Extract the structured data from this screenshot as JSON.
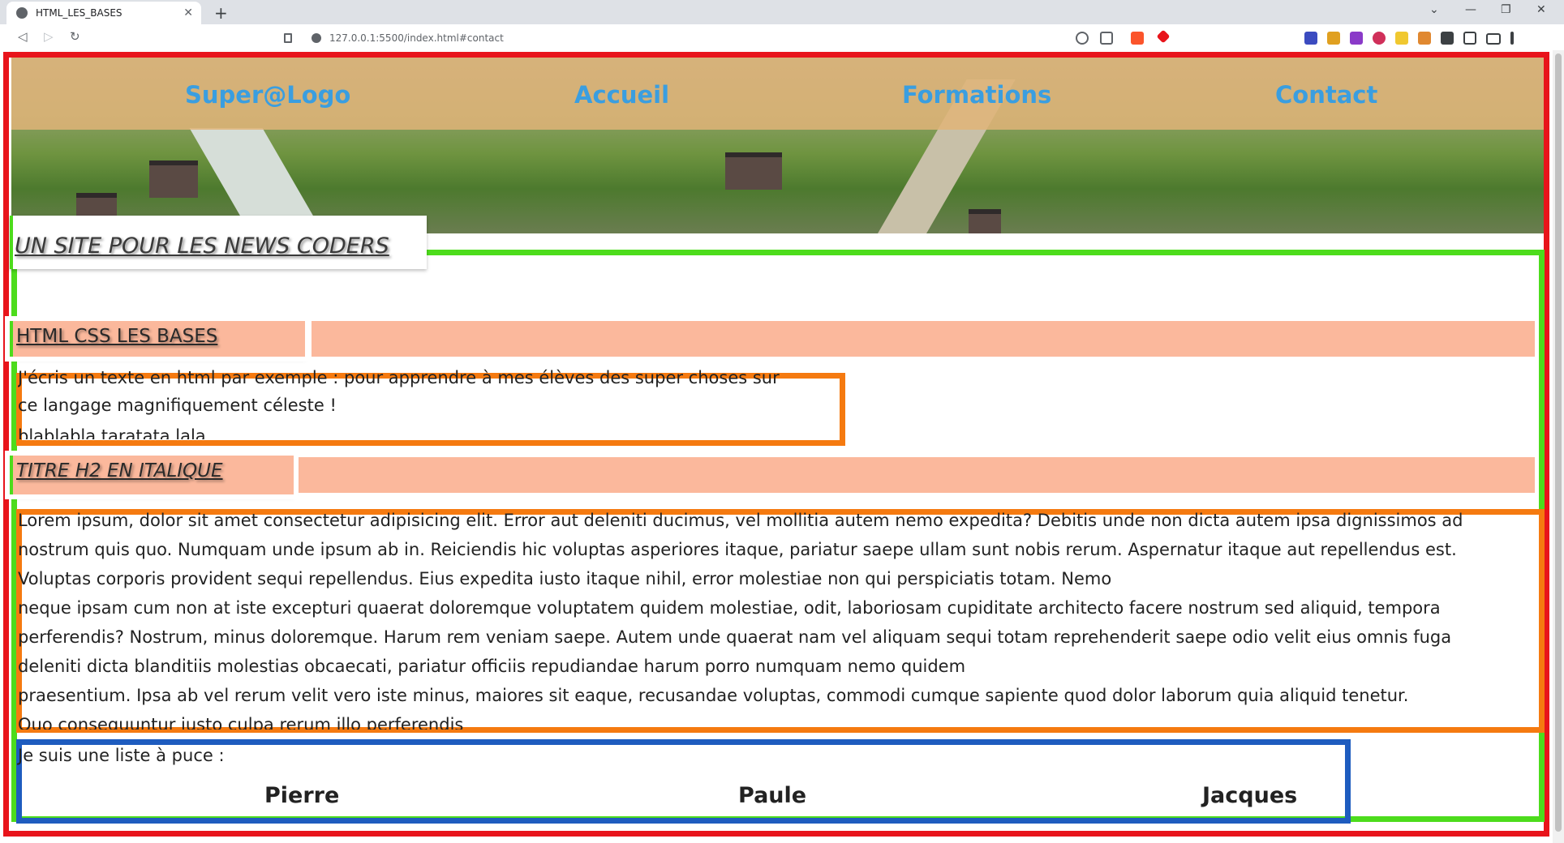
{
  "browser": {
    "tab_title": "HTML_LES_BASES",
    "tab_close": "✕",
    "new_tab": "+",
    "url": "127.0.0.1:5500/index.html#contact",
    "back": "◁",
    "forward": "▷",
    "reload": "↻",
    "minimize": "—",
    "restore": "❐",
    "close": "✕",
    "tab_menu": "⌄"
  },
  "nav": {
    "logo": "Super@Logo",
    "items": [
      "Accueil",
      "Formations",
      "Contact"
    ]
  },
  "content": {
    "h1": "UN SITE POUR LES NEWS CODERS",
    "h2_first": "HTML CSS LES BASES",
    "intro_lines": [
      "J'écris un texte en html par exemple : pour apprendre à mes élèves des super choses sur",
      "ce langage magnifiquement céleste !",
      "blablabla taratata lala"
    ],
    "h2_second": "TITRE H2 EN ITALIQUE",
    "lorem_lines": [
      "Lorem ipsum, dolor sit amet consectetur adipisicing elit. Error aut deleniti ducimus, vel mollitia autem nemo expedita? Debitis unde non dicta autem ipsa dignissimos ad",
      "nostrum quis quo. Numquam unde ipsum ab in. Reiciendis hic voluptas asperiores itaque, pariatur saepe ullam sunt nobis rerum. Aspernatur itaque aut repellendus est.",
      "Voluptas corporis provident sequi repellendus. Eius expedita iusto itaque nihil, error molestiae non qui perspiciatis totam. Nemo",
      "neque ipsam cum non at iste excepturi quaerat doloremque voluptatem quidem molestiae, odit, laboriosam cupiditate architecto facere nostrum sed aliquid, tempora",
      "perferendis? Nostrum, minus doloremque. Harum rem veniam saepe. Autem unde quaerat nam vel aliquam sequi totam reprehenderit saepe odio velit eius omnis fuga",
      "deleniti dicta blanditiis molestias obcaecati, pariatur officiis repudiandae harum porro numquam nemo quidem",
      "praesentium. Ipsa ab vel rerum velit vero iste minus, maiores sit eaque, recusandae voluptas, commodi cumque sapiente quod dolor laborum quia aliquid tenetur.",
      "Quo consequuntur iusto culpa rerum illo perferendis"
    ],
    "list_intro": "Je suis une liste à puce :",
    "list_items": [
      "Pierre",
      "Paule",
      "Jacques"
    ]
  },
  "colors": {
    "red_border": "#e8141b",
    "green_border": "#4ddc1c",
    "orange_border": "#f57a10",
    "blue_border": "#1e5cbf",
    "salmon_bg": "#fbb89c",
    "nav_text": "#3a9ee0"
  },
  "icons": [
    "favicon-icon",
    "back-icon",
    "forward-icon",
    "reload-icon",
    "bookmark-icon",
    "info-icon",
    "zoom-icon",
    "share-icon",
    "brave-icon",
    "extension-icon",
    "sidebar-icon",
    "wallet-icon",
    "menu-icon"
  ]
}
